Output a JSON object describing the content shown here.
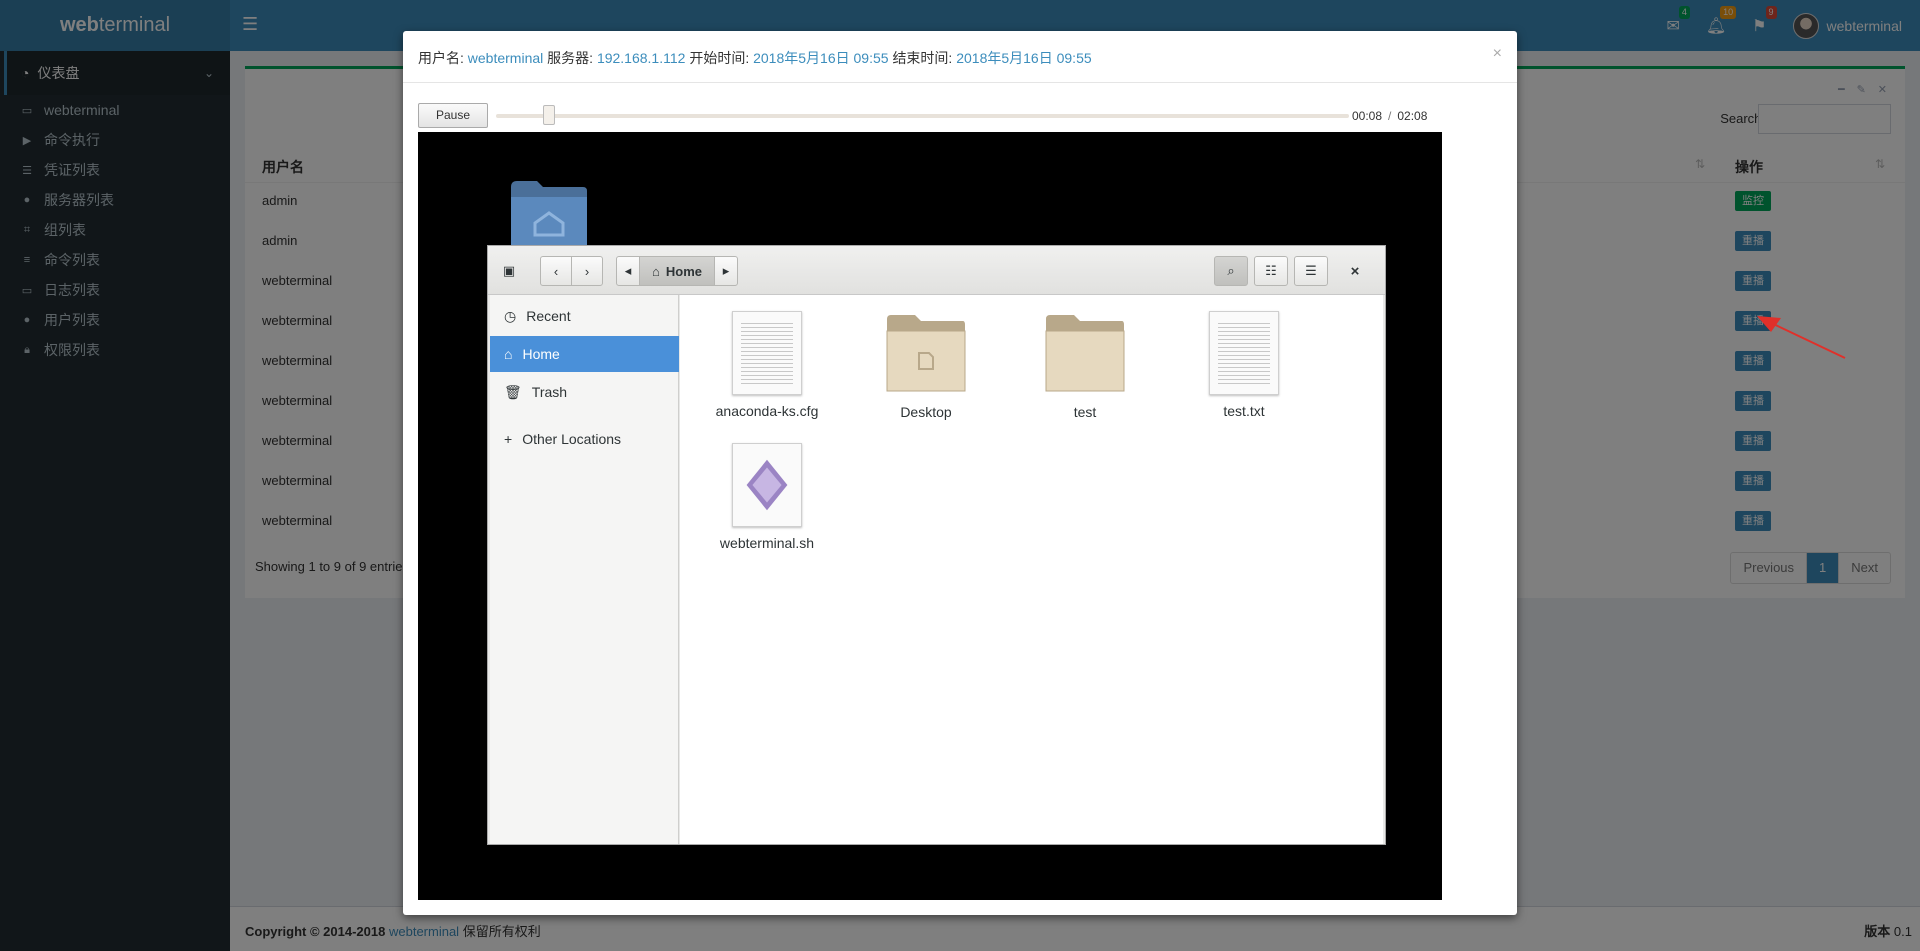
{
  "app": {
    "logo_prefix": "web",
    "logo_suffix": "terminal"
  },
  "topnav": {
    "badges": {
      "messages": "4",
      "notifications": "10",
      "tasks": "9"
    },
    "user": "webterminal"
  },
  "sidebar": {
    "header": "仪表盘",
    "items": [
      {
        "label": "webterminal",
        "icon": "laptop-icon"
      },
      {
        "label": "命令执行",
        "icon": "play-icon"
      },
      {
        "label": "凭证列表",
        "icon": "list-ol-icon"
      },
      {
        "label": "服务器列表",
        "icon": "circle-icon"
      },
      {
        "label": "组列表",
        "icon": "crop-icon"
      },
      {
        "label": "命令列表",
        "icon": "list-icon"
      },
      {
        "label": "日志列表",
        "icon": "desktop-icon"
      },
      {
        "label": "用户列表",
        "icon": "user-icon"
      },
      {
        "label": "权限列表",
        "icon": "lock-icon"
      }
    ]
  },
  "table": {
    "search_label": "Search:",
    "col_user": "用户名",
    "col_action": "操作",
    "rows": [
      {
        "user": "admin",
        "action": "监控"
      },
      {
        "user": "admin",
        "action": "重播"
      },
      {
        "user": "webterminal",
        "action": "重播"
      },
      {
        "user": "webterminal",
        "action": "重播"
      },
      {
        "user": "webterminal",
        "action": "重播"
      },
      {
        "user": "webterminal",
        "action": "重播"
      },
      {
        "user": "webterminal",
        "action": "重播"
      },
      {
        "user": "webterminal",
        "action": "重播"
      },
      {
        "user": "webterminal",
        "action": "重播"
      }
    ],
    "showing": "Showing 1 to 9 of 9 entrie",
    "pager": {
      "previous": "Previous",
      "page": "1",
      "next": "Next"
    }
  },
  "footer": {
    "copyright": "Copyright © 2014-2018",
    "link": "webterminal",
    "rights": "保留所有权利",
    "version_label": "版本",
    "version": "0.1"
  },
  "modal": {
    "user_label": "用户名:",
    "user": "webterminal",
    "server_label": "服务器:",
    "server": "192.168.1.112",
    "start_label": "开始时间:",
    "start": "2018年5月16日 09:55",
    "end_label": "结束时间:",
    "end": "2018年5月16日 09:55",
    "close": "×",
    "player": {
      "pause": "Pause",
      "current": "00:08",
      "separator": "/",
      "total": "02:08",
      "progress": 0.0625
    }
  },
  "file_manager": {
    "path": "Home",
    "close": "×",
    "sidebar": [
      {
        "label": "Recent",
        "icon": "clock-icon"
      },
      {
        "label": "Home",
        "icon": "home-icon"
      },
      {
        "label": "Trash",
        "icon": "trash-icon"
      },
      {
        "label": "Other Locations",
        "icon": "plus-icon"
      }
    ],
    "files": [
      {
        "name": "anaconda-ks.cfg",
        "type": "document"
      },
      {
        "name": "Desktop",
        "type": "folder"
      },
      {
        "name": "test",
        "type": "folder"
      },
      {
        "name": "test.txt",
        "type": "document"
      },
      {
        "name": "webterminal.sh",
        "type": "script"
      }
    ]
  }
}
